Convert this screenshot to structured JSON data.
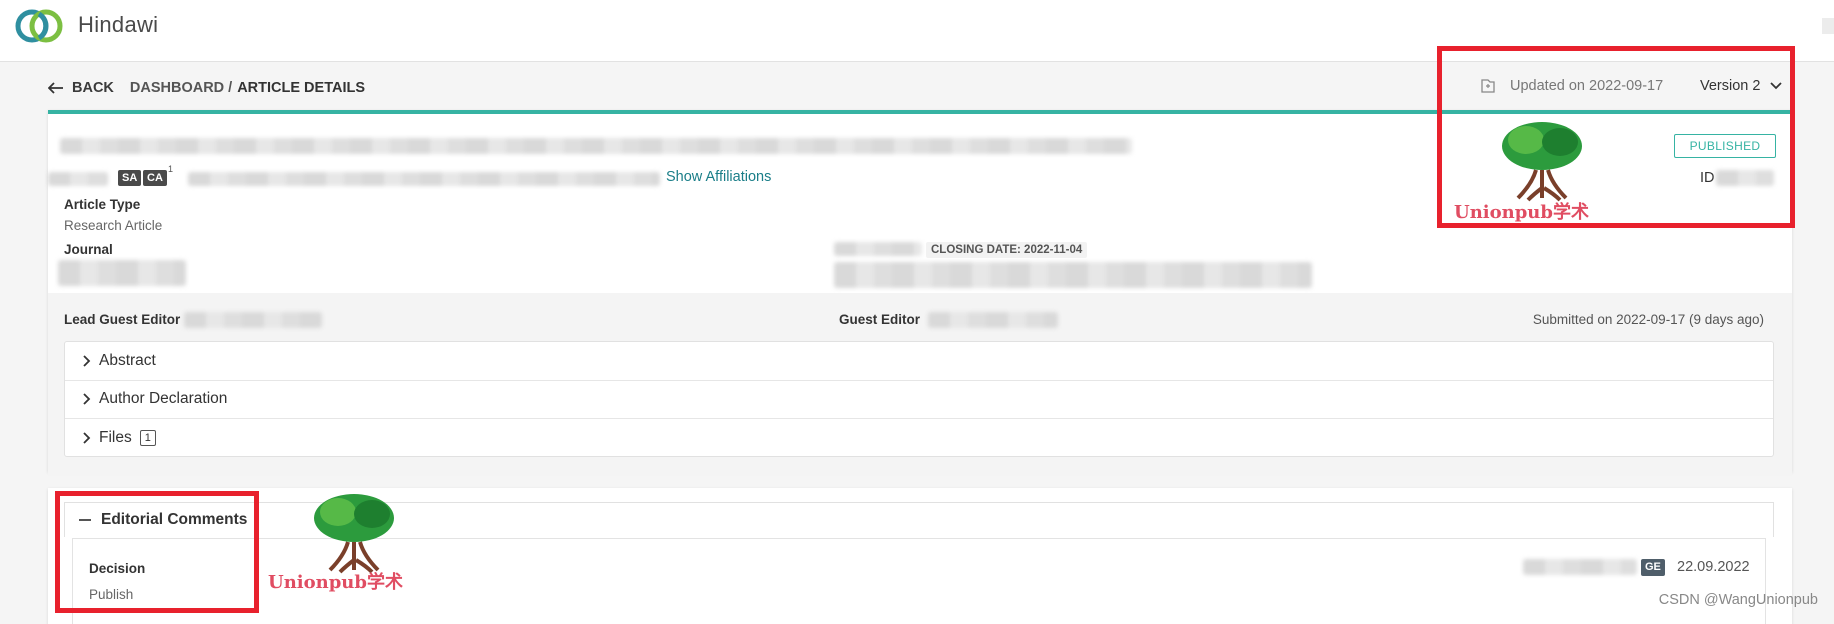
{
  "brand": {
    "name": "Hindawi"
  },
  "nav": {
    "back_label": "BACK",
    "crumb_dashboard": "DASHBOARD /",
    "crumb_current": "ARTICLE DETAILS",
    "updated": "Updated on 2022-09-17",
    "version": "Version 2"
  },
  "article": {
    "author_badges": [
      "SA",
      "CA"
    ],
    "author_sup": "1",
    "show_affiliations": "Show Affiliations",
    "article_type_label": "Article Type",
    "article_type_value": "Research Article",
    "journal_label": "Journal",
    "closing_date": "CLOSING DATE: 2022-11-04",
    "status": "PUBLISHED",
    "id_label": "ID",
    "lead_guest_editor_label": "Lead Guest Editor",
    "guest_editor_label": "Guest Editor",
    "submitted": "Submitted on 2022-09-17 (9 days ago)"
  },
  "accordion": {
    "items": [
      {
        "label": "Abstract"
      },
      {
        "label": "Author Declaration"
      },
      {
        "label": "Files",
        "count": "1"
      }
    ]
  },
  "editorial": {
    "title": "Editorial Comments",
    "decision_label": "Decision",
    "decision_value": "Publish",
    "role_tag": "GE",
    "date": "22.09.2022"
  },
  "watermarks": {
    "text": "Unionpub学术",
    "csdn": "CSDN @WangUnionpub"
  },
  "colors": {
    "accent": "#36b3a3",
    "link": "#1a7e88",
    "highlight": "#e8212d"
  }
}
